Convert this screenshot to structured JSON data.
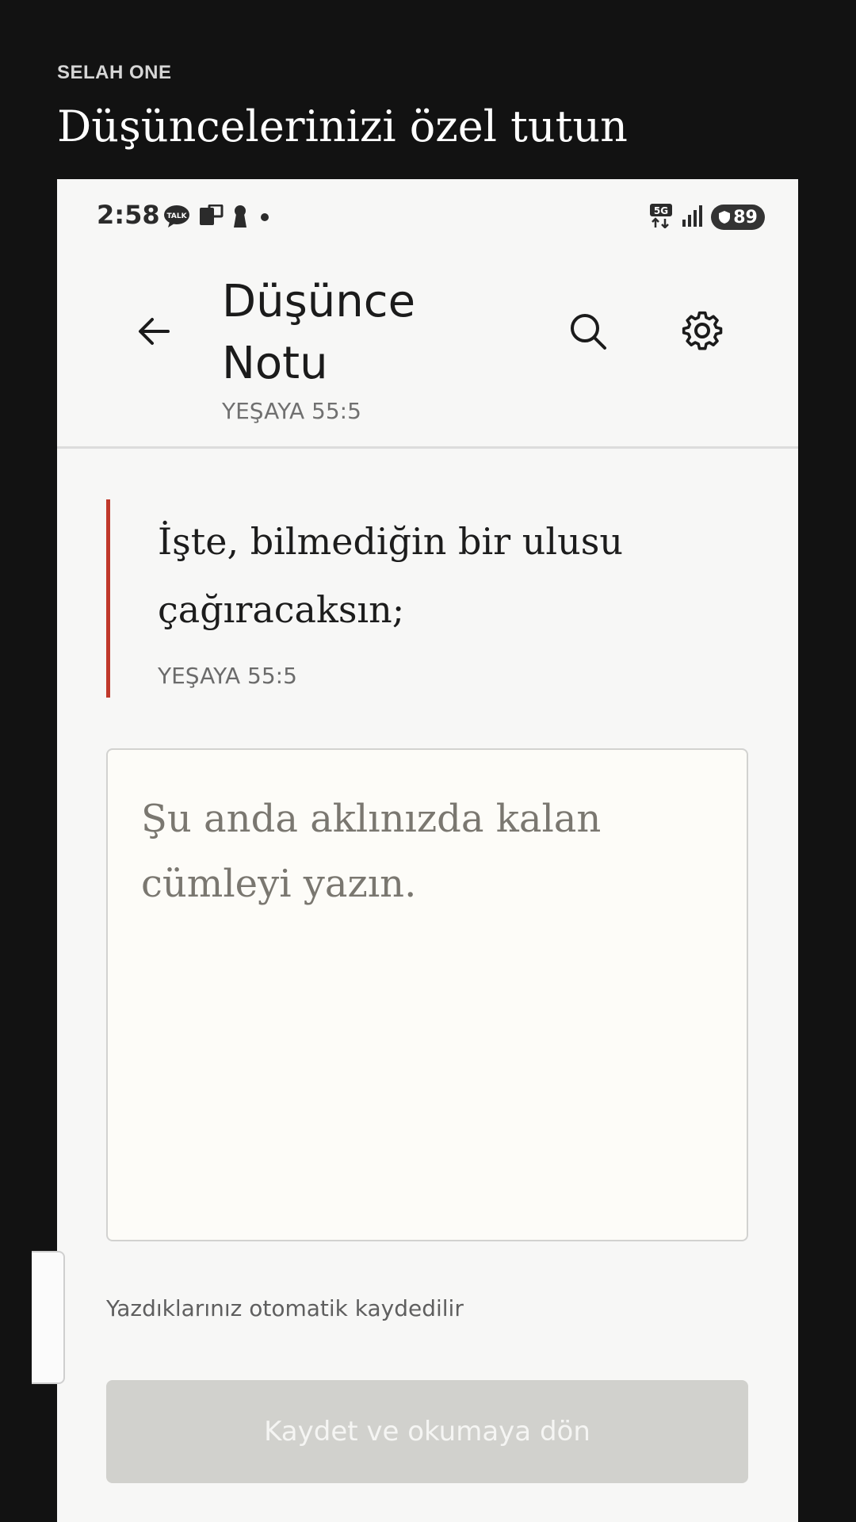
{
  "promo": {
    "brand": "SELAH ONE",
    "headline": "Düşüncelerinizi özel tutun"
  },
  "status_bar": {
    "time": "2:58",
    "network": "5G",
    "battery": "89",
    "icons": [
      "talk-chat-icon",
      "device-icon",
      "keyhole-icon",
      "dot-icon",
      "signal-icon",
      "battery-icon"
    ]
  },
  "app_bar": {
    "title": "Düşünce Notu",
    "subtitle": "YEŞAYA 55:5",
    "icons": [
      "back-arrow-icon",
      "search-icon",
      "gear-icon"
    ]
  },
  "verse": {
    "text": "İşte, bilmediğin bir ulusu çağıracaksın;",
    "reference": "YEŞAYA 55:5",
    "accent_color": "#c0392b"
  },
  "note": {
    "value": "",
    "placeholder": "Şu anda aklınızda kalan cümleyi yazın."
  },
  "autosave_text": "Yazdıklarınız otomatik kaydedilir",
  "save_button": {
    "label": "Kaydet ve okumaya dön"
  }
}
